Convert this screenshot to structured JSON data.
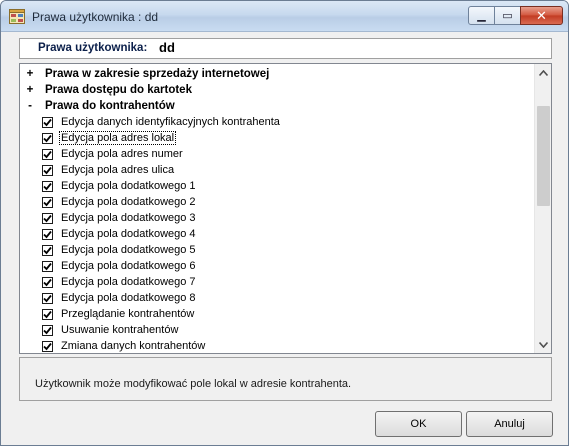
{
  "window": {
    "title": "Prawa użytkownika : dd",
    "minimize_glyph": "▁",
    "maximize_glyph": "▭",
    "close_glyph": "✕"
  },
  "header": {
    "label": "Prawa użytkownika:",
    "value": "dd"
  },
  "tree": {
    "groups": [
      {
        "expander": "+",
        "label": "Prawa w zakresie sprzedaży internetowej"
      },
      {
        "expander": "+",
        "label": "Prawa dostępu do kartotek"
      },
      {
        "expander": "-",
        "label": "Prawa do kontrahentów"
      }
    ],
    "items": [
      {
        "label": "Edycja danych identyfikacyjnych kontrahenta",
        "checked": true
      },
      {
        "label": "Edycja pola adres lokal",
        "checked": true,
        "selected": true
      },
      {
        "label": "Edycja pola adres numer",
        "checked": true
      },
      {
        "label": "Edycja pola adres ulica",
        "checked": true
      },
      {
        "label": "Edycja pola dodatkowego 1",
        "checked": true
      },
      {
        "label": "Edycja pola dodatkowego 2",
        "checked": true
      },
      {
        "label": "Edycja pola dodatkowego 3",
        "checked": true
      },
      {
        "label": "Edycja pola dodatkowego 4",
        "checked": true
      },
      {
        "label": "Edycja pola dodatkowego 5",
        "checked": true
      },
      {
        "label": "Edycja pola dodatkowego 6",
        "checked": true
      },
      {
        "label": "Edycja pola dodatkowego 7",
        "checked": true
      },
      {
        "label": "Edycja pola dodatkowego 8",
        "checked": true
      },
      {
        "label": "Przeglądanie kontrahentów",
        "checked": true
      },
      {
        "label": "Usuwanie kontrahentów",
        "checked": true
      },
      {
        "label": "Zmiana danych kontrahentów",
        "checked": true
      }
    ]
  },
  "description": "Użytkownik może modyfikować pole lokal w adresie kontrahenta.",
  "buttons": {
    "ok": "OK",
    "cancel": "Anuluj"
  }
}
